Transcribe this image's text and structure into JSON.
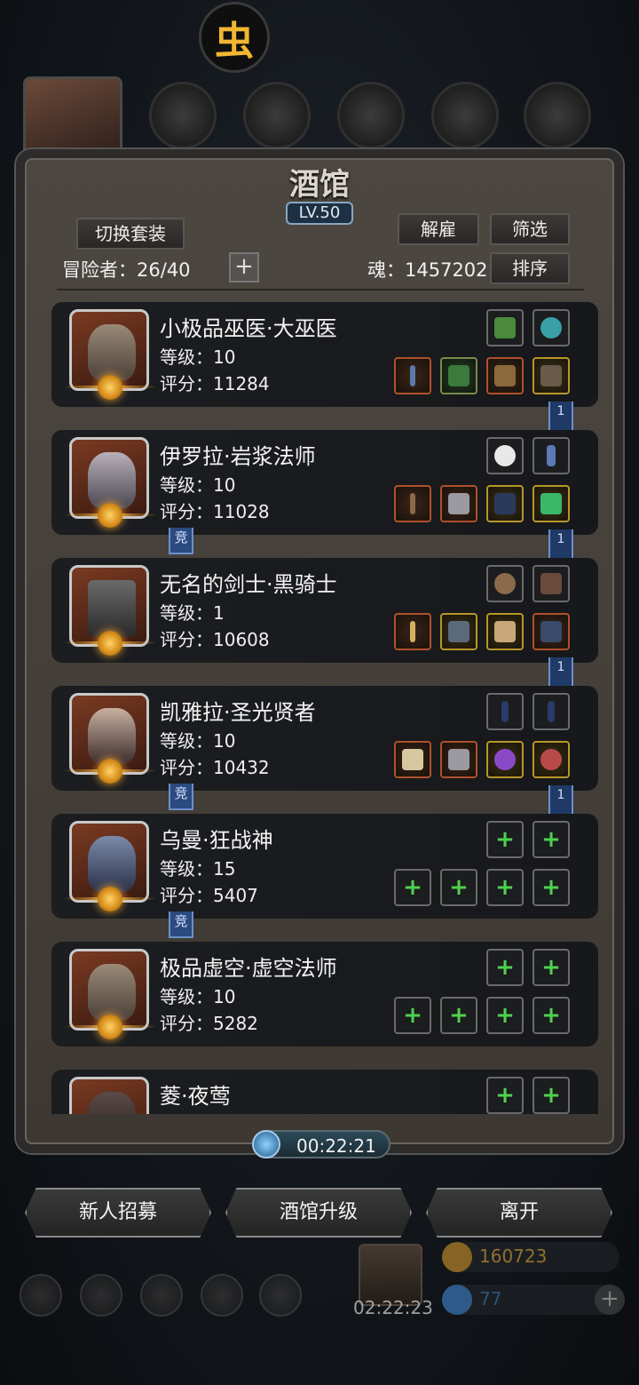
{
  "header": {
    "emblem_glyph": "虫",
    "title": "酒馆",
    "level": "LV.50"
  },
  "toolbar": {
    "switch_set": "切换套装",
    "dismiss": "解雇",
    "filter": "筛选",
    "sort": "排序",
    "adventurers_label": "冒险者：26/40",
    "soul_label": "魂：1457202"
  },
  "heroes": [
    {
      "name": "小极品巫医·大巫医",
      "level": "等级：10",
      "score": "评分：11284"
    },
    {
      "name": "伊罗拉·岩浆法师",
      "level": "等级：10",
      "score": "评分：11028"
    },
    {
      "name": "无名的剑士·黑骑士",
      "level": "等级：1",
      "score": "评分：10608"
    },
    {
      "name": "凯雅拉·圣光贤者",
      "level": "等级：10",
      "score": "评分：10432"
    },
    {
      "name": "乌曼·狂战神",
      "level": "等级：15",
      "score": "评分：5407"
    },
    {
      "name": "极品虚空·虚空法师",
      "level": "等级：10",
      "score": "评分：5282"
    },
    {
      "name": "菱·夜莺",
      "level": "",
      "score": ""
    }
  ],
  "ribbons": {
    "rank": "1",
    "compete": "竞"
  },
  "timer": "00:22:21",
  "bottom_buttons": {
    "recruit": "新人招募",
    "upgrade": "酒馆升级",
    "leave": "离开"
  },
  "background": {
    "gift_timer": "02:22:23",
    "gold": "160723",
    "gems": "77"
  },
  "colors": {
    "gold_text": "#c69a3a",
    "gem_text": "#3e6fa0",
    "add_green": "#4fd14f"
  }
}
